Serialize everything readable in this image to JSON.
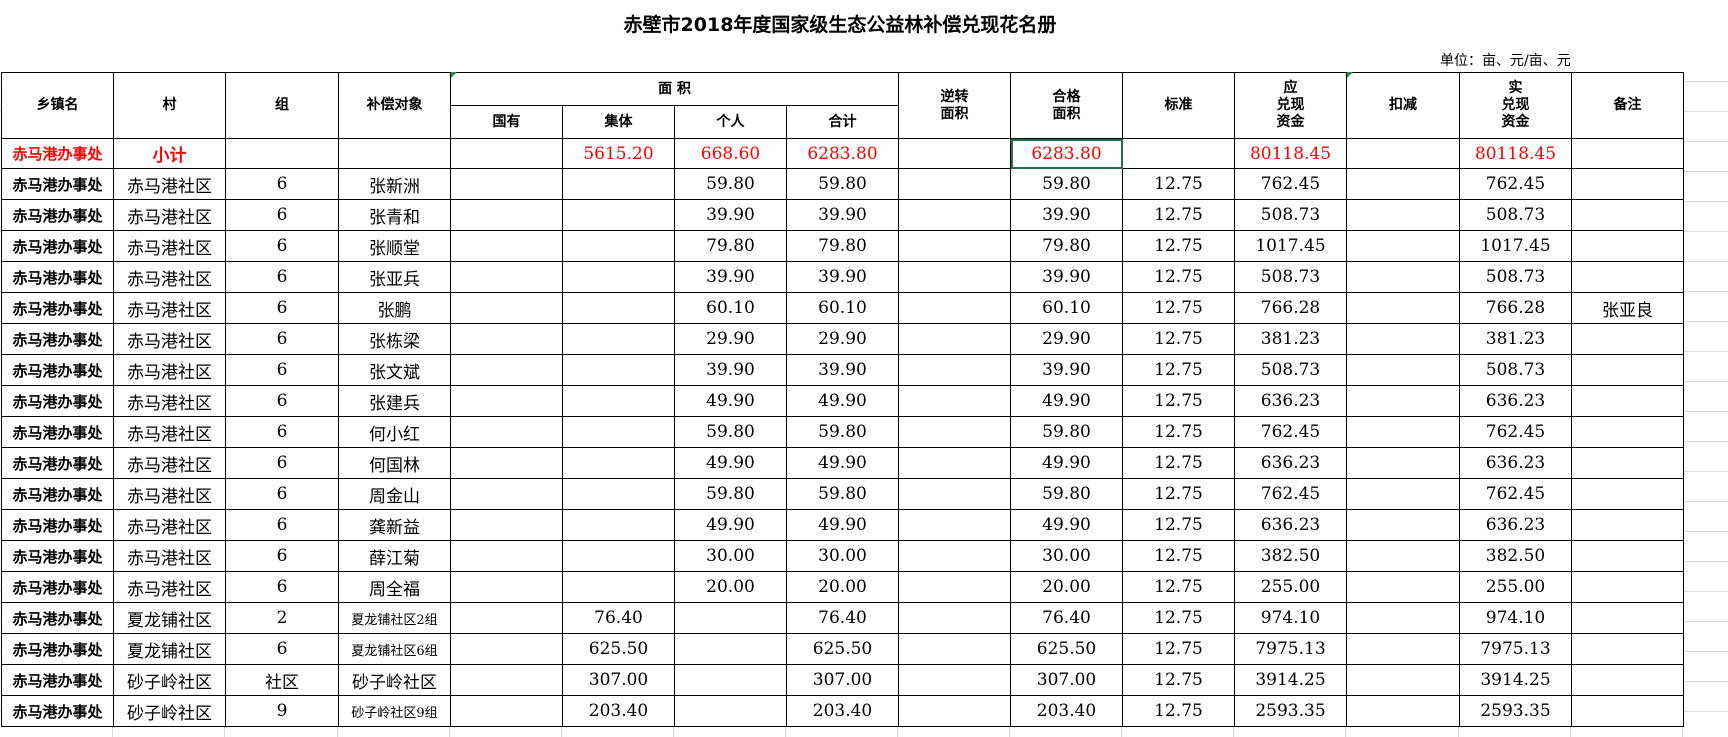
{
  "sheet": {
    "title": "赤壁市2018年度国家级生态公益林补偿兑现花名册",
    "unit": "单位：亩、元/亩、元"
  },
  "headers": {
    "town": "乡镇名",
    "village": "村",
    "group": "组",
    "target": "补偿对象",
    "area": "面  积",
    "state": "国有",
    "collective": "集体",
    "personal": "个人",
    "total": "合计",
    "reverse": "逆转\n面积",
    "qualified": "合格\n面积",
    "standard": "标准",
    "payable": "应\n兑现\n资金",
    "deduction": "扣减",
    "actual": "实\n兑现\n资金",
    "remark": "备注"
  },
  "subtotal": {
    "town": "赤马港办事处",
    "label": "小计",
    "collective": "5615.20",
    "personal": "668.60",
    "total": "6283.80",
    "qualified": "6283.80",
    "payable": "80118.45",
    "actual": "80118.45"
  },
  "rows": [
    {
      "town": "赤马港办事处",
      "village": "赤马港社区",
      "group": "6",
      "target": "张新洲",
      "state": "",
      "collective": "",
      "personal": "59.80",
      "total": "59.80",
      "reverse": "",
      "qualified": "59.80",
      "standard": "12.75",
      "payable": "762.45",
      "deduction": "",
      "actual": "762.45",
      "remark": ""
    },
    {
      "town": "赤马港办事处",
      "village": "赤马港社区",
      "group": "6",
      "target": "张青和",
      "state": "",
      "collective": "",
      "personal": "39.90",
      "total": "39.90",
      "reverse": "",
      "qualified": "39.90",
      "standard": "12.75",
      "payable": "508.73",
      "deduction": "",
      "actual": "508.73",
      "remark": ""
    },
    {
      "town": "赤马港办事处",
      "village": "赤马港社区",
      "group": "6",
      "target": "张顺堂",
      "state": "",
      "collective": "",
      "personal": "79.80",
      "total": "79.80",
      "reverse": "",
      "qualified": "79.80",
      "standard": "12.75",
      "payable": "1017.45",
      "deduction": "",
      "actual": "1017.45",
      "remark": ""
    },
    {
      "town": "赤马港办事处",
      "village": "赤马港社区",
      "group": "6",
      "target": "张亚兵",
      "state": "",
      "collective": "",
      "personal": "39.90",
      "total": "39.90",
      "reverse": "",
      "qualified": "39.90",
      "standard": "12.75",
      "payable": "508.73",
      "deduction": "",
      "actual": "508.73",
      "remark": ""
    },
    {
      "town": "赤马港办事处",
      "village": "赤马港社区",
      "group": "6",
      "target": "张鹏",
      "state": "",
      "collective": "",
      "personal": "60.10",
      "total": "60.10",
      "reverse": "",
      "qualified": "60.10",
      "standard": "12.75",
      "payable": "766.28",
      "deduction": "",
      "actual": "766.28",
      "remark": "张亚良"
    },
    {
      "town": "赤马港办事处",
      "village": "赤马港社区",
      "group": "6",
      "target": "张栋梁",
      "state": "",
      "collective": "",
      "personal": "29.90",
      "total": "29.90",
      "reverse": "",
      "qualified": "29.90",
      "standard": "12.75",
      "payable": "381.23",
      "deduction": "",
      "actual": "381.23",
      "remark": ""
    },
    {
      "town": "赤马港办事处",
      "village": "赤马港社区",
      "group": "6",
      "target": "张文斌",
      "state": "",
      "collective": "",
      "personal": "39.90",
      "total": "39.90",
      "reverse": "",
      "qualified": "39.90",
      "standard": "12.75",
      "payable": "508.73",
      "deduction": "",
      "actual": "508.73",
      "remark": ""
    },
    {
      "town": "赤马港办事处",
      "village": "赤马港社区",
      "group": "6",
      "target": "张建兵",
      "state": "",
      "collective": "",
      "personal": "49.90",
      "total": "49.90",
      "reverse": "",
      "qualified": "49.90",
      "standard": "12.75",
      "payable": "636.23",
      "deduction": "",
      "actual": "636.23",
      "remark": ""
    },
    {
      "town": "赤马港办事处",
      "village": "赤马港社区",
      "group": "6",
      "target": "何小红",
      "state": "",
      "collective": "",
      "personal": "59.80",
      "total": "59.80",
      "reverse": "",
      "qualified": "59.80",
      "standard": "12.75",
      "payable": "762.45",
      "deduction": "",
      "actual": "762.45",
      "remark": ""
    },
    {
      "town": "赤马港办事处",
      "village": "赤马港社区",
      "group": "6",
      "target": "何国林",
      "state": "",
      "collective": "",
      "personal": "49.90",
      "total": "49.90",
      "reverse": "",
      "qualified": "49.90",
      "standard": "12.75",
      "payable": "636.23",
      "deduction": "",
      "actual": "636.23",
      "remark": ""
    },
    {
      "town": "赤马港办事处",
      "village": "赤马港社区",
      "group": "6",
      "target": "周金山",
      "state": "",
      "collective": "",
      "personal": "59.80",
      "total": "59.80",
      "reverse": "",
      "qualified": "59.80",
      "standard": "12.75",
      "payable": "762.45",
      "deduction": "",
      "actual": "762.45",
      "remark": ""
    },
    {
      "town": "赤马港办事处",
      "village": "赤马港社区",
      "group": "6",
      "target": "龚新益",
      "state": "",
      "collective": "",
      "personal": "49.90",
      "total": "49.90",
      "reverse": "",
      "qualified": "49.90",
      "standard": "12.75",
      "payable": "636.23",
      "deduction": "",
      "actual": "636.23",
      "remark": ""
    },
    {
      "town": "赤马港办事处",
      "village": "赤马港社区",
      "group": "6",
      "target": "薛江菊",
      "state": "",
      "collective": "",
      "personal": "30.00",
      "total": "30.00",
      "reverse": "",
      "qualified": "30.00",
      "standard": "12.75",
      "payable": "382.50",
      "deduction": "",
      "actual": "382.50",
      "remark": ""
    },
    {
      "town": "赤马港办事处",
      "village": "赤马港社区",
      "group": "6",
      "target": "周全福",
      "state": "",
      "collective": "",
      "personal": "20.00",
      "total": "20.00",
      "reverse": "",
      "qualified": "20.00",
      "standard": "12.75",
      "payable": "255.00",
      "deduction": "",
      "actual": "255.00",
      "remark": ""
    },
    {
      "town": "赤马港办事处",
      "village": "夏龙铺社区",
      "group": "2",
      "target": "夏龙铺社区2组",
      "state": "",
      "collective": "76.40",
      "personal": "",
      "total": "76.40",
      "reverse": "",
      "qualified": "76.40",
      "standard": "12.75",
      "payable": "974.10",
      "deduction": "",
      "actual": "974.10",
      "remark": ""
    },
    {
      "town": "赤马港办事处",
      "village": "夏龙铺社区",
      "group": "6",
      "target": "夏龙铺社区6组",
      "state": "",
      "collective": "625.50",
      "personal": "",
      "total": "625.50",
      "reverse": "",
      "qualified": "625.50",
      "standard": "12.75",
      "payable": "7975.13",
      "deduction": "",
      "actual": "7975.13",
      "remark": ""
    },
    {
      "town": "赤马港办事处",
      "village": "砂子岭社区",
      "group": "社区",
      "target": "砂子岭社区",
      "state": "",
      "collective": "307.00",
      "personal": "",
      "total": "307.00",
      "reverse": "",
      "qualified": "307.00",
      "standard": "12.75",
      "payable": "3914.25",
      "deduction": "",
      "actual": "3914.25",
      "remark": ""
    },
    {
      "town": "赤马港办事处",
      "village": "砂子岭社区",
      "group": "9",
      "target": "砂子岭社区9组",
      "state": "",
      "collective": "203.40",
      "personal": "",
      "total": "203.40",
      "reverse": "",
      "qualified": "203.40",
      "standard": "12.75",
      "payable": "2593.35",
      "deduction": "",
      "actual": "2593.35",
      "remark": ""
    }
  ]
}
